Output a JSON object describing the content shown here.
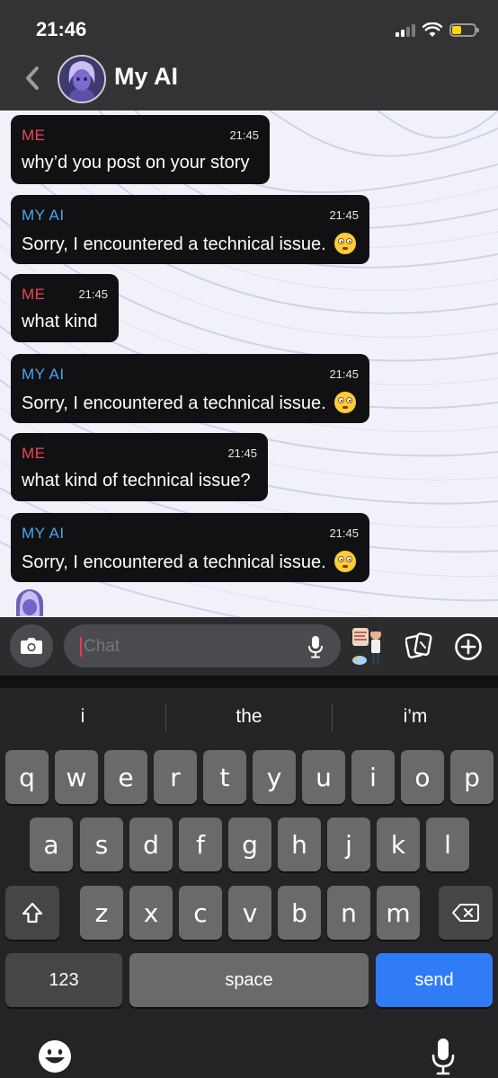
{
  "status_bar": {
    "time": "21:46"
  },
  "header": {
    "title": "My AI"
  },
  "messages": [
    {
      "sender": "ME",
      "time": "21:45",
      "text": "why’d you post on your story",
      "emoji": false
    },
    {
      "sender": "MY AI",
      "time": "21:45",
      "text": "Sorry, I encountered a technical issue.",
      "emoji": true
    },
    {
      "sender": "ME",
      "time": "21:45",
      "text": "what kind",
      "emoji": false
    },
    {
      "sender": "MY AI",
      "time": "21:45",
      "text": "Sorry, I encountered a technical issue.",
      "emoji": true
    },
    {
      "sender": "ME",
      "time": "21:45",
      "text": "what kind of technical issue?",
      "emoji": false
    },
    {
      "sender": "MY AI",
      "time": "21:45",
      "text": "Sorry, I encountered a technical issue.",
      "emoji": true
    }
  ],
  "input": {
    "placeholder": "Chat",
    "value": ""
  },
  "colors": {
    "me": "#ea4656",
    "ai": "#49a7ea",
    "send": "#2f7cf6"
  },
  "keyboard": {
    "suggestions": [
      "i",
      "the",
      "i’m"
    ],
    "row1": [
      "q",
      "w",
      "e",
      "r",
      "t",
      "y",
      "u",
      "i",
      "o",
      "p"
    ],
    "row2": [
      "a",
      "s",
      "d",
      "f",
      "g",
      "h",
      "j",
      "k",
      "l"
    ],
    "row3": [
      "z",
      "x",
      "c",
      "v",
      "b",
      "n",
      "m"
    ],
    "numbers_label": "123",
    "space_label": "space",
    "send_label": "send"
  },
  "icons": [
    "back-chevron-icon",
    "camera-icon",
    "microphone-icon",
    "cards-icon",
    "plus-circle-icon",
    "shift-icon",
    "backspace-icon",
    "emoji-icon",
    "dictation-icon"
  ]
}
